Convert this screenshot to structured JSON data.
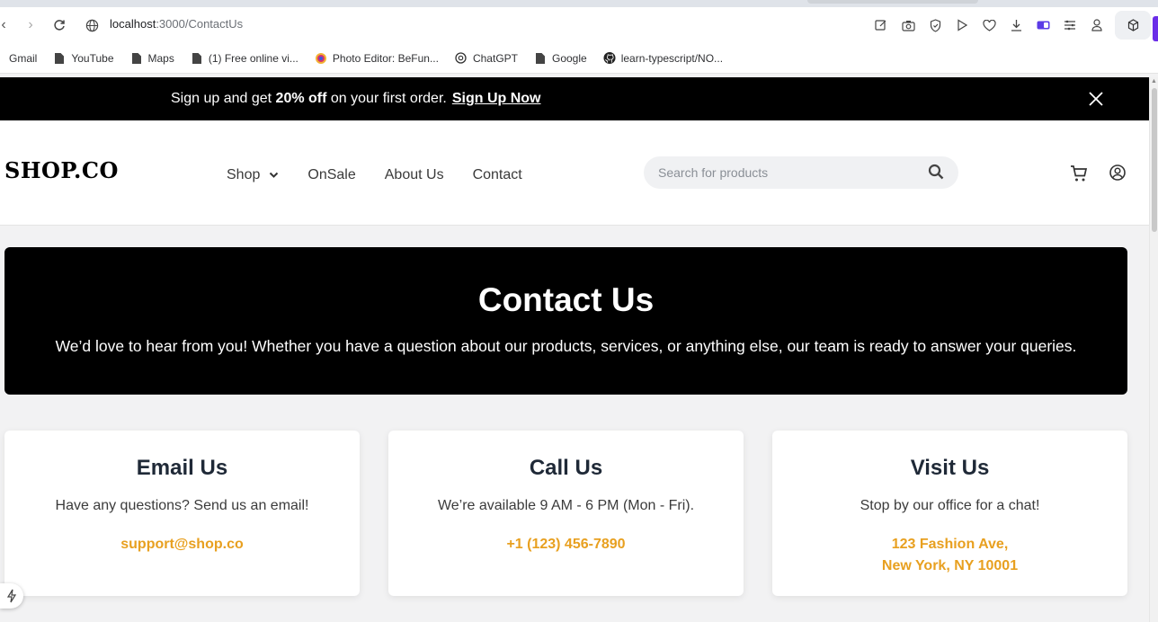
{
  "browser": {
    "url_host": "localhost",
    "url_path": ":3000/ContactUs",
    "bookmarks": [
      {
        "label": "Gmail",
        "icon": "gmail-icon"
      },
      {
        "label": "YouTube",
        "icon": "page-icon"
      },
      {
        "label": "Maps",
        "icon": "page-icon"
      },
      {
        "label": "(1)  Free online vi...",
        "icon": "page-icon"
      },
      {
        "label": "Photo Editor: BeFun...",
        "icon": "befunky-icon"
      },
      {
        "label": "ChatGPT",
        "icon": "chatgpt-icon"
      },
      {
        "label": "Google",
        "icon": "page-icon"
      },
      {
        "label": "learn-typescript/NO...",
        "icon": "github-icon"
      }
    ]
  },
  "promo": {
    "text_before": "Sign up and get ",
    "highlight": "20% off",
    "text_after": " on your first order.",
    "link": "Sign Up Now"
  },
  "header": {
    "logo": "SHOP.CO",
    "nav": {
      "shop": "Shop",
      "on_sale": "OnSale",
      "about": "About Us",
      "contact": "Contact"
    },
    "search_placeholder": "Search for products"
  },
  "hero": {
    "title": "Contact Us",
    "subtitle": "We’d love to hear from you! Whether you have a question about our products, services, or anything else, our team is ready to answer your queries."
  },
  "cards": {
    "email": {
      "title": "Email Us",
      "description": "Have any questions? Send us an email!",
      "contact": "support@shop.co"
    },
    "call": {
      "title": "Call Us",
      "description": "We’re available 9 AM - 6 PM (Mon - Fri).",
      "contact": "+1 (123) 456-7890"
    },
    "visit": {
      "title": "Visit Us",
      "description": "Stop by our office for a chat!",
      "address_line1": "123 Fashion Ave,",
      "address_line2": "New York, NY 10001"
    }
  },
  "colors": {
    "accent": "#e8a020",
    "promo_bg": "#000000",
    "hero_bg": "#000000",
    "page_bg": "#f2f2f3"
  }
}
